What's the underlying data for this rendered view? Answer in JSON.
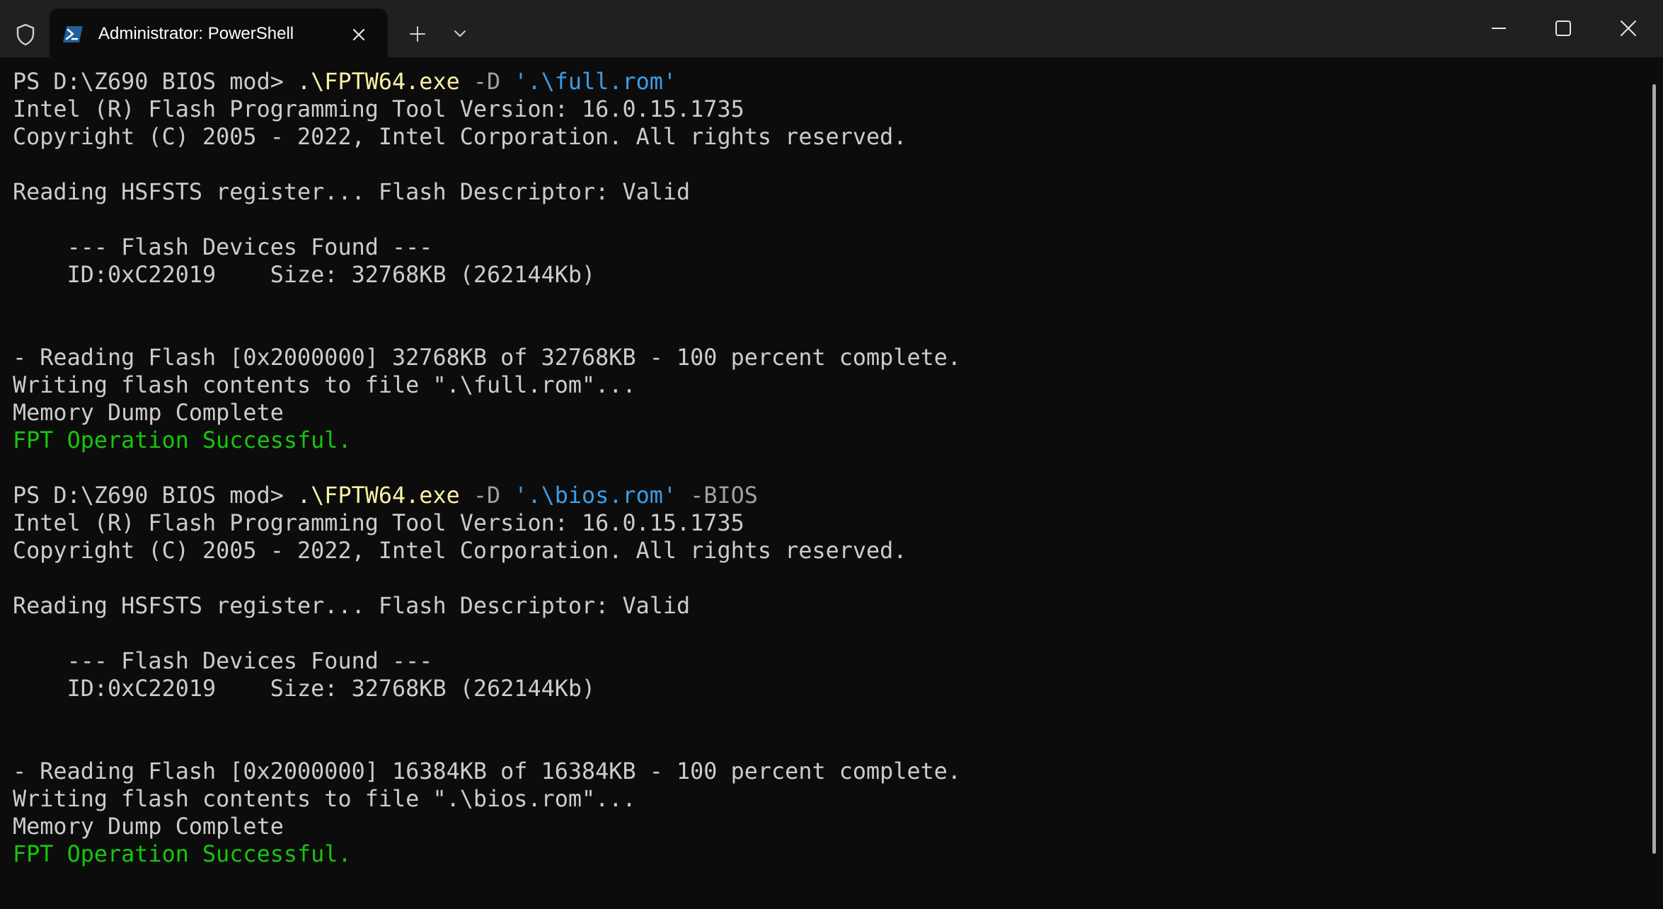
{
  "window": {
    "tab_title": "Administrator: PowerShell",
    "icons": {
      "admin": "shield-icon",
      "tab": "powershell-icon",
      "tab_close": "close-icon",
      "new_tab": "plus-icon",
      "dropdown": "chevron-down-icon",
      "minimize": "minimize-icon",
      "maximize": "maximize-icon",
      "close": "close-icon"
    }
  },
  "colors": {
    "background": "#0c0c0c",
    "titlebar": "#202020",
    "text": "#cccccc",
    "executable": "#f9f1a5",
    "string": "#3b9de8",
    "parameter": "#a0a0a0",
    "success": "#16c60c"
  },
  "terminal": {
    "lines": [
      [
        {
          "t": "PS D:\\Z690 BIOS mod> ",
          "c": "prompt"
        },
        {
          "t": ".\\FPTW64.exe",
          "c": "exe"
        },
        {
          "t": " -D ",
          "c": "param"
        },
        {
          "t": "'.\\full.rom'",
          "c": "string"
        }
      ],
      [
        {
          "t": "Intel (R) Flash Programming Tool Version: 16.0.15.1735",
          "c": "out"
        }
      ],
      [
        {
          "t": "Copyright (C) 2005 - 2022, Intel Corporation. All rights reserved.",
          "c": "out"
        }
      ],
      [],
      [
        {
          "t": "Reading HSFSTS register... Flash Descriptor: Valid",
          "c": "out"
        }
      ],
      [],
      [
        {
          "t": "    --- Flash Devices Found ---",
          "c": "out"
        }
      ],
      [
        {
          "t": "    ID:0xC22019    Size: 32768KB (262144Kb)",
          "c": "out"
        }
      ],
      [],
      [],
      [
        {
          "t": "- Reading Flash [0x2000000] 32768KB of 32768KB - 100 percent complete.",
          "c": "out"
        }
      ],
      [
        {
          "t": "Writing flash contents to file \".\\full.rom\"...",
          "c": "out"
        }
      ],
      [
        {
          "t": "Memory Dump Complete",
          "c": "out"
        }
      ],
      [
        {
          "t": "FPT Operation Successful.",
          "c": "success"
        }
      ],
      [],
      [
        {
          "t": "PS D:\\Z690 BIOS mod> ",
          "c": "prompt"
        },
        {
          "t": ".\\FPTW64.exe",
          "c": "exe"
        },
        {
          "t": " -D ",
          "c": "param"
        },
        {
          "t": "'.\\bios.rom'",
          "c": "string"
        },
        {
          "t": " -BIOS",
          "c": "param"
        }
      ],
      [
        {
          "t": "Intel (R) Flash Programming Tool Version: 16.0.15.1735",
          "c": "out"
        }
      ],
      [
        {
          "t": "Copyright (C) 2005 - 2022, Intel Corporation. All rights reserved.",
          "c": "out"
        }
      ],
      [],
      [
        {
          "t": "Reading HSFSTS register... Flash Descriptor: Valid",
          "c": "out"
        }
      ],
      [],
      [
        {
          "t": "    --- Flash Devices Found ---",
          "c": "out"
        }
      ],
      [
        {
          "t": "    ID:0xC22019    Size: 32768KB (262144Kb)",
          "c": "out"
        }
      ],
      [],
      [],
      [
        {
          "t": "- Reading Flash [0x2000000] 16384KB of 16384KB - 100 percent complete.",
          "c": "out"
        }
      ],
      [
        {
          "t": "Writing flash contents to file \".\\bios.rom\"...",
          "c": "out"
        }
      ],
      [
        {
          "t": "Memory Dump Complete",
          "c": "out"
        }
      ],
      [
        {
          "t": "FPT Operation Successful.",
          "c": "success"
        }
      ]
    ]
  }
}
